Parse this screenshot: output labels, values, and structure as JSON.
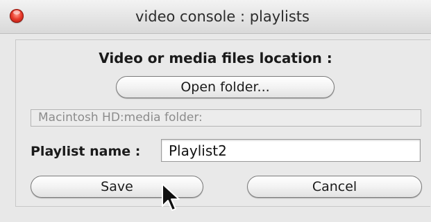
{
  "window": {
    "title": "video console : playlists"
  },
  "location": {
    "heading": "Video or media files location :",
    "open_button_label": "Open folder...",
    "path_value": "Macintosh HD:media folder:"
  },
  "playlist": {
    "label": "Playlist name :",
    "value": "Playlist2"
  },
  "actions": {
    "save_label": "Save",
    "cancel_label": "Cancel"
  },
  "icons": {
    "close": "close-icon",
    "pointer": "mouse-pointer-icon"
  },
  "colors": {
    "close_button": "#e8392a",
    "window_bg": "#e8e8e8"
  }
}
